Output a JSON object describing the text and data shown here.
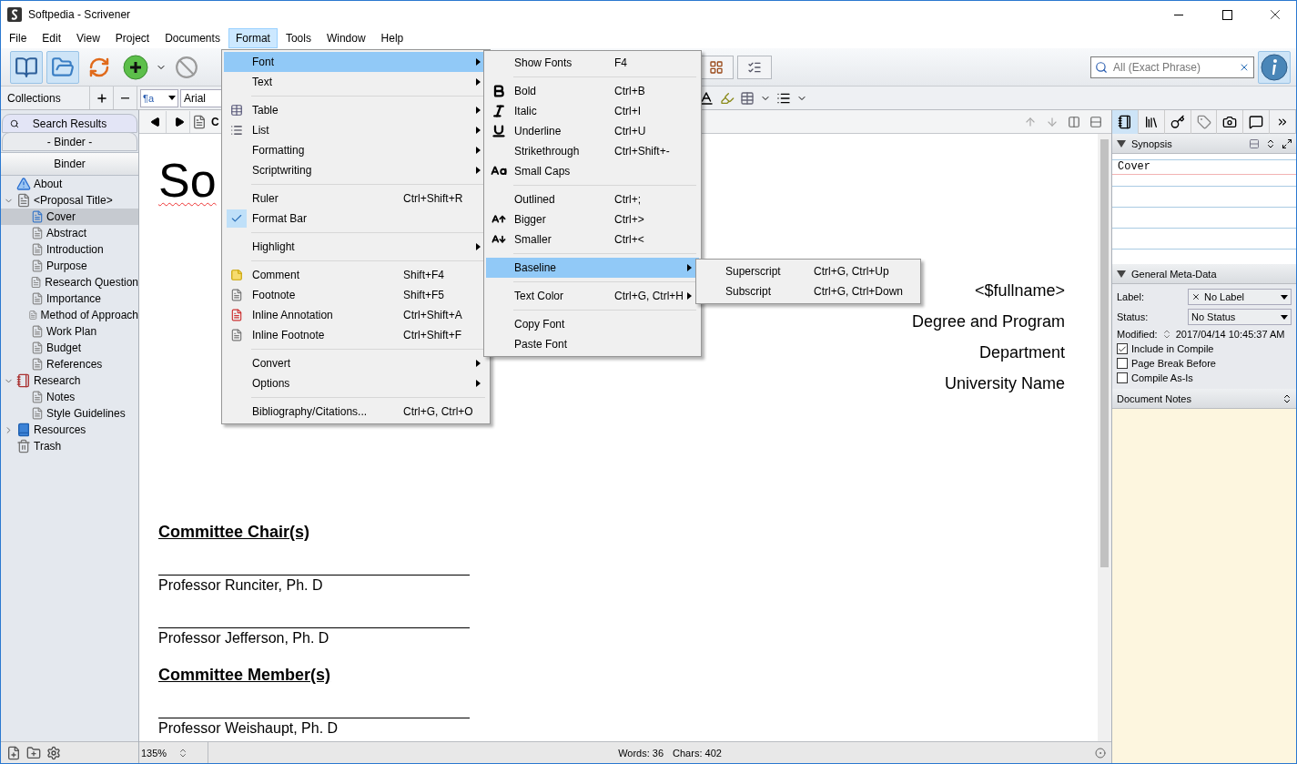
{
  "window": {
    "title": "Softpedia - Scrivener"
  },
  "menu_bar": [
    {
      "label": "File",
      "selected": false
    },
    {
      "label": "Edit",
      "selected": false
    },
    {
      "label": "View",
      "selected": false
    },
    {
      "label": "Project",
      "selected": false
    },
    {
      "label": "Documents",
      "selected": false
    },
    {
      "label": "Format",
      "selected": true
    },
    {
      "label": "Tools",
      "selected": false
    },
    {
      "label": "Window",
      "selected": false
    },
    {
      "label": "Help",
      "selected": false
    }
  ],
  "toolbar": {
    "binder_on": true,
    "collections_on": true,
    "search": {
      "placeholder": "All (Exact Phrase)"
    }
  },
  "format_bar": {
    "style": "¶a",
    "font": "Arial"
  },
  "collections": {
    "label": "Collections"
  },
  "binder": {
    "tabs": [
      {
        "label": "Search Results"
      },
      {
        "label": "- Binder -"
      }
    ],
    "header": "Binder",
    "items": [
      {
        "label": "About",
        "kind": "info",
        "selected": false
      },
      {
        "label": "<Proposal Title>",
        "kind": "folder",
        "selected": false,
        "expanded": true,
        "children": [
          {
            "label": "Cover",
            "kind": "doc",
            "selected": true
          },
          {
            "label": "Abstract",
            "kind": "doc",
            "selected": false
          },
          {
            "label": "Introduction",
            "kind": "doc",
            "selected": false
          },
          {
            "label": "Purpose",
            "kind": "doc",
            "selected": false
          },
          {
            "label": "Research Question",
            "kind": "doc",
            "selected": false
          },
          {
            "label": "Importance",
            "kind": "doc",
            "selected": false
          },
          {
            "label": "Method of Approach",
            "kind": "doc",
            "selected": false
          },
          {
            "label": "Work Plan",
            "kind": "doc",
            "selected": false
          },
          {
            "label": "Budget",
            "kind": "doc",
            "selected": false
          },
          {
            "label": "References",
            "kind": "doc",
            "selected": false
          }
        ]
      },
      {
        "label": "Research",
        "kind": "research",
        "selected": false,
        "expanded": true,
        "children": [
          {
            "label": "Notes",
            "kind": "doc",
            "selected": false
          },
          {
            "label": "Style Guidelines",
            "kind": "doc",
            "selected": false
          }
        ]
      },
      {
        "label": "Resources",
        "kind": "resources",
        "selected": false,
        "expanded": false
      },
      {
        "label": "Trash",
        "kind": "trash",
        "selected": false
      }
    ]
  },
  "editor": {
    "header_title": "C",
    "title": "So",
    "address_lines": [
      "<$fullname>",
      "Degree and Program",
      "Department",
      "University Name"
    ],
    "sections": [
      {
        "kind": "heading",
        "text": "Committee Chair(s)"
      },
      {
        "kind": "signature",
        "text": "Professor Runciter, Ph. D"
      },
      {
        "kind": "signature",
        "text": "Professor Jefferson, Ph. D"
      },
      {
        "kind": "heading",
        "text": "Committee Member(s)"
      },
      {
        "kind": "signature",
        "text": "Professor Weishaupt, Ph. D"
      }
    ]
  },
  "inspector": {
    "synopsis": {
      "title": "Synopsis",
      "text": "Cover"
    },
    "metadata": {
      "title": "General Meta-Data",
      "fields": [
        {
          "label": "Label:",
          "value": "No Label",
          "kind": "label"
        },
        {
          "label": "Status:",
          "value": "No Status",
          "kind": "status"
        }
      ],
      "modified_label": "Modified:",
      "modified": "2017/04/14 10:45:37 AM",
      "checkboxes": [
        {
          "label": "Include in Compile",
          "checked": true
        },
        {
          "label": "Page Break Before",
          "checked": false
        },
        {
          "label": "Compile As-Is",
          "checked": false
        }
      ]
    },
    "notes_title": "Document Notes"
  },
  "status_bar": {
    "zoom": "135%",
    "words": "Words: 36",
    "chars": "Chars: 402"
  },
  "format_menu": {
    "groups": [
      [
        {
          "label": "Font",
          "kind": "plain",
          "submenu": true,
          "selected": true,
          "checked": false
        },
        {
          "label": "Text",
          "kind": "plain",
          "submenu": true,
          "selected": false,
          "checked": false
        }
      ],
      [
        {
          "label": "Table",
          "kind": "table",
          "submenu": true,
          "selected": false,
          "checked": false
        },
        {
          "label": "List",
          "kind": "list",
          "submenu": true,
          "selected": false,
          "checked": false
        },
        {
          "label": "Formatting",
          "kind": "plain",
          "submenu": true,
          "selected": false,
          "checked": false
        },
        {
          "label": "Scriptwriting",
          "kind": "plain",
          "submenu": true,
          "selected": false,
          "checked": false
        }
      ],
      [
        {
          "label": "Ruler",
          "shortcut": "Ctrl+Shift+R",
          "kind": "plain",
          "submenu": false,
          "selected": false,
          "checked": false
        },
        {
          "label": "Format Bar",
          "submenu": false,
          "selected": false,
          "checked": true
        }
      ],
      [
        {
          "label": "Highlight",
          "kind": "plain",
          "submenu": true,
          "selected": false,
          "checked": false
        }
      ],
      [
        {
          "label": "Comment",
          "shortcut": "Shift+F4",
          "kind": "comment",
          "submenu": false,
          "selected": false,
          "checked": false
        },
        {
          "label": "Footnote",
          "shortcut": "Shift+F5",
          "kind": "footnote",
          "submenu": false,
          "selected": false,
          "checked": false
        },
        {
          "label": "Inline Annotation",
          "shortcut": "Ctrl+Shift+A",
          "kind": "annotation",
          "submenu": false,
          "selected": false,
          "checked": false
        },
        {
          "label": "Inline Footnote",
          "shortcut": "Ctrl+Shift+F",
          "kind": "footnote",
          "submenu": false,
          "selected": false,
          "checked": false
        }
      ],
      [
        {
          "label": "Convert",
          "kind": "plain",
          "submenu": true,
          "selected": false,
          "checked": false
        },
        {
          "label": "Options",
          "kind": "plain",
          "submenu": true,
          "selected": false,
          "checked": false
        }
      ],
      [
        {
          "label": "Bibliography/Citations...",
          "shortcut": "Ctrl+G, Ctrl+O",
          "kind": "plain",
          "submenu": false,
          "selected": false,
          "checked": false
        }
      ]
    ]
  },
  "font_menu": {
    "groups": [
      [
        {
          "label": "Show Fonts",
          "shortcut": "F4",
          "kind": "plain",
          "submenu": false,
          "selected": false
        }
      ],
      [
        {
          "label": "Bold",
          "shortcut": "Ctrl+B",
          "kind": "bold",
          "submenu": false,
          "selected": false
        },
        {
          "label": "Italic",
          "shortcut": "Ctrl+I",
          "kind": "italic",
          "submenu": false,
          "selected": false
        },
        {
          "label": "Underline",
          "shortcut": "Ctrl+U",
          "kind": "underline",
          "submenu": false,
          "selected": false
        },
        {
          "label": "Strikethrough",
          "shortcut": "Ctrl+Shift+-",
          "kind": "plain",
          "submenu": false,
          "selected": false
        },
        {
          "label": "Small Caps",
          "kind": "small-caps",
          "submenu": false,
          "selected": false
        }
      ],
      [
        {
          "label": "Outlined",
          "shortcut": "Ctrl+;",
          "kind": "plain",
          "submenu": false,
          "selected": false
        },
        {
          "label": "Bigger",
          "shortcut": "Ctrl+>",
          "kind": "bigger",
          "submenu": false,
          "selected": false
        },
        {
          "label": "Smaller",
          "shortcut": "Ctrl+<",
          "kind": "smaller",
          "submenu": false,
          "selected": false
        }
      ],
      [
        {
          "label": "Baseline",
          "kind": "plain",
          "submenu": true,
          "selected": true
        }
      ],
      [
        {
          "label": "Text Color",
          "shortcut": "Ctrl+G, Ctrl+H",
          "kind": "plain",
          "submenu": true,
          "selected": false
        }
      ],
      [
        {
          "label": "Copy Font",
          "kind": "plain",
          "submenu": false,
          "selected": false
        },
        {
          "label": "Paste Font",
          "kind": "plain",
          "submenu": false,
          "selected": false
        }
      ]
    ]
  },
  "baseline_menu": {
    "groups": [
      [
        {
          "label": "Superscript",
          "shortcut": "Ctrl+G, Ctrl+Up",
          "submenu": false,
          "selected": false
        },
        {
          "label": "Subscript",
          "shortcut": "Ctrl+G, Ctrl+Down",
          "submenu": false,
          "selected": false
        }
      ]
    ]
  }
}
